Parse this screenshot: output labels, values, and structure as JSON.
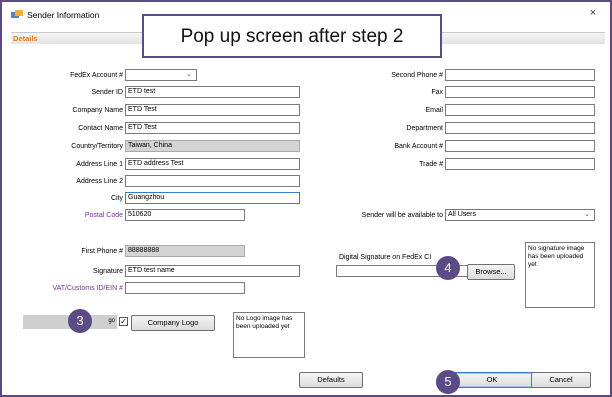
{
  "window": {
    "title": "Sender Information",
    "close": "×"
  },
  "section": {
    "details": "Details"
  },
  "callout": {
    "text": "Pop up screen after step 2"
  },
  "left_fields": {
    "fedex_account_label": "FedEx Account #",
    "fedex_account_value": "",
    "sender_id_label": "Sender ID",
    "sender_id_value": "ETD test",
    "company_name_label": "Company Name",
    "company_name_value": "ETD Test",
    "contact_name_label": "Contact Name",
    "contact_name_value": "ETD Test",
    "country_label": "Country/Territory",
    "country_value": "Taiwan, China",
    "address1_label": "Address Line 1",
    "address1_value": "ETD address Test",
    "address2_label": "Address Line 2",
    "address2_value": "",
    "city_label": "City",
    "city_value": "Guangzhou",
    "postal_label": "Postal Code",
    "postal_value": "510620",
    "first_phone_label": "First Phone #",
    "first_phone_value": "88888888",
    "signature_label": "Signature",
    "signature_value": "ETD test name",
    "vat_label": "VAT/Customs ID/EIN #",
    "vat_value": ""
  },
  "right_fields": {
    "second_phone_label": "Second Phone #",
    "fax_label": "Fax",
    "email_label": "Email",
    "department_label": "Department",
    "bank_account_label": "Bank Account #",
    "trade_label": "Trade #",
    "available_label": "Sender will be available to",
    "available_value": "All Users",
    "digital_sig_label": "Digital Signature on FedEx CI"
  },
  "buttons": {
    "browse": "Browse...",
    "company_logo": "Company Logo",
    "defaults": "Defaults",
    "ok": "OK",
    "cancel": "Cancel"
  },
  "logo_strip_text": "go",
  "image_boxes": {
    "signature_placeholder": "No signature image has been uploaded yet",
    "logo_placeholder": "No Logo image has been uploaded yet"
  },
  "badges": {
    "b3": "3",
    "b4": "4",
    "b5": "5"
  },
  "icons": {
    "dropdown": "chevron-down-icon",
    "checkbox": "checkbox-checked-icon"
  }
}
